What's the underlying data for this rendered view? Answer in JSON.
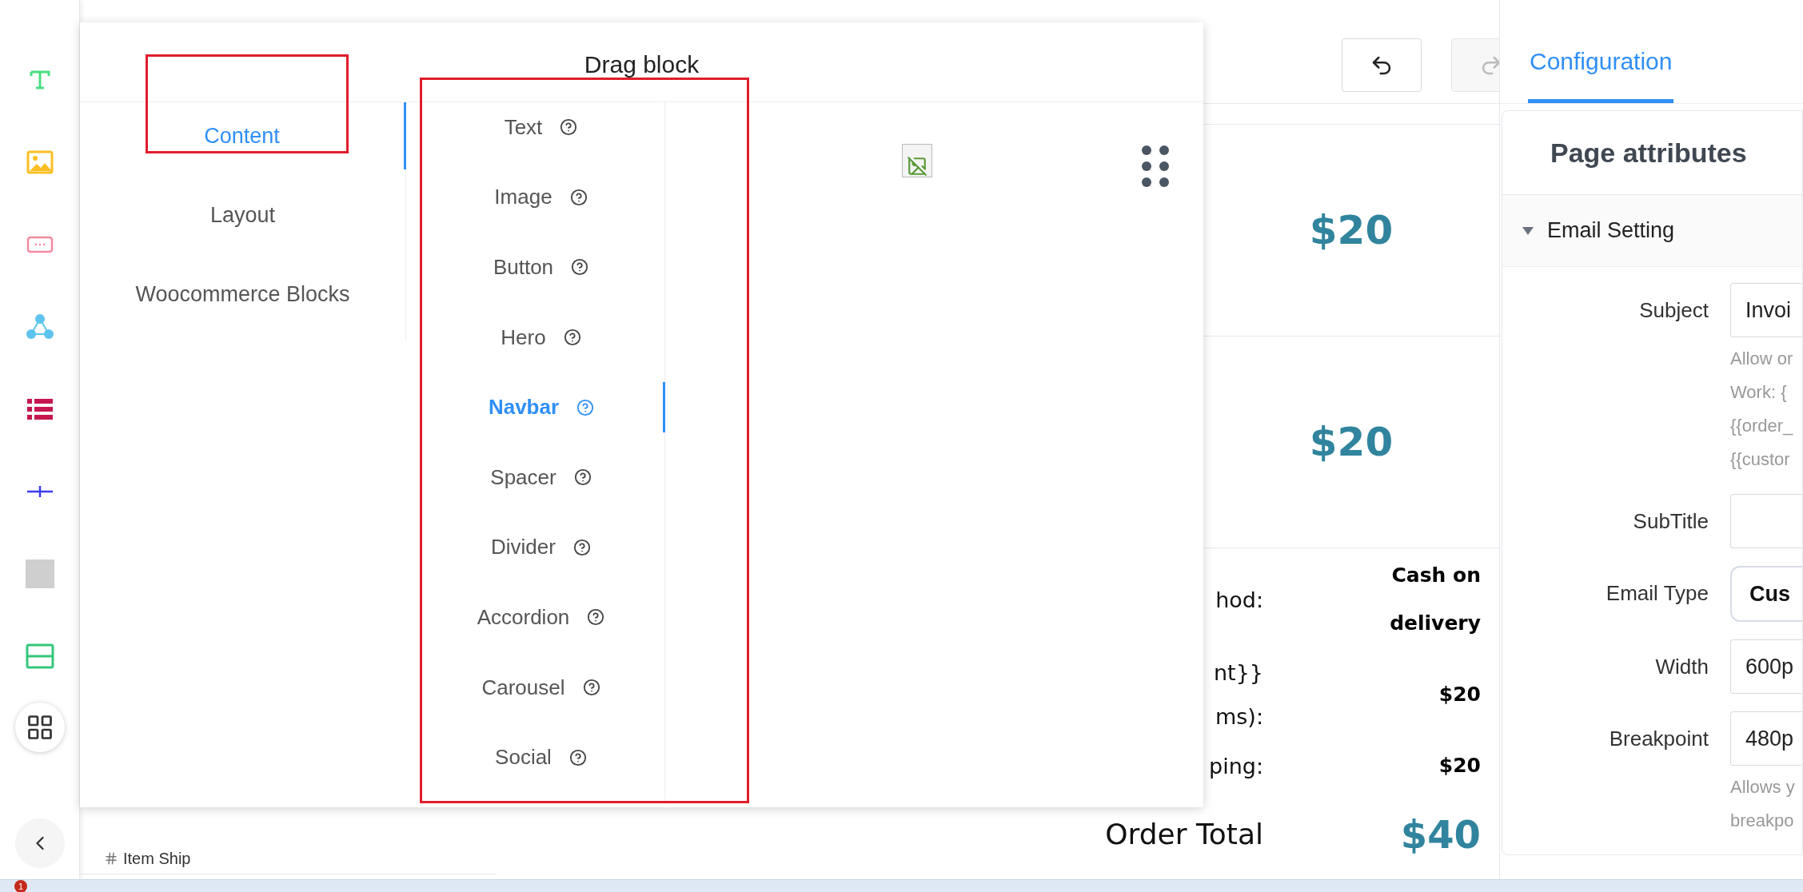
{
  "toolbar": {
    "tools": [
      {
        "kind": "text"
      },
      {
        "kind": "image"
      },
      {
        "kind": "button"
      },
      {
        "kind": "share"
      },
      {
        "kind": "list"
      },
      {
        "kind": "divider"
      },
      {
        "kind": "block"
      },
      {
        "kind": "section"
      }
    ]
  },
  "drag_panel": {
    "title": "Drag block",
    "categories": [
      {
        "label": "Content",
        "selected": true
      },
      {
        "label": "Layout",
        "selected": false
      },
      {
        "label": "Woocommerce Blocks",
        "selected": false
      }
    ],
    "blocks": [
      {
        "label": "Text",
        "selected": false
      },
      {
        "label": "Image",
        "selected": false
      },
      {
        "label": "Button",
        "selected": false
      },
      {
        "label": "Hero",
        "selected": false
      },
      {
        "label": "Navbar",
        "selected": true
      },
      {
        "label": "Spacer",
        "selected": false
      },
      {
        "label": "Divider",
        "selected": false
      },
      {
        "label": "Accordion",
        "selected": false
      },
      {
        "label": "Carousel",
        "selected": false
      },
      {
        "label": "Social",
        "selected": false
      }
    ]
  },
  "preview": {
    "prices": [
      "$20",
      "$20"
    ],
    "summary_rows": [
      {
        "label": [
          "hod:"
        ],
        "value": "Cash on delivery"
      },
      {
        "label": [
          "nt}}",
          "ms):"
        ],
        "value": "$20"
      },
      {
        "label": [
          "ping:"
        ],
        "value": "$20"
      }
    ],
    "total": {
      "label": "Order Total",
      "value": "$40"
    }
  },
  "layers": {
    "items": [
      {
        "label": "Item Ship"
      }
    ]
  },
  "settings": {
    "tabs": [
      {
        "label": "Configuration",
        "selected": true
      }
    ],
    "title": "Page attributes",
    "section": {
      "label": "Email Setting",
      "expanded": true
    },
    "fields": [
      {
        "label": "Subject",
        "kind": "input",
        "value": "Invoi",
        "help": [
          "Allow or",
          "Work: {",
          "{{order_",
          "{{custor"
        ]
      },
      {
        "label": "SubTitle",
        "kind": "input"
      },
      {
        "label": "Email Type",
        "kind": "select",
        "value": "Cus"
      },
      {
        "label": "Width",
        "kind": "input",
        "value": "600p"
      },
      {
        "label": "Breakpoint",
        "kind": "input",
        "value": "480p",
        "help": [
          "Allows y",
          "breakpo"
        ]
      }
    ]
  },
  "taskbar": {
    "badge": "1"
  }
}
